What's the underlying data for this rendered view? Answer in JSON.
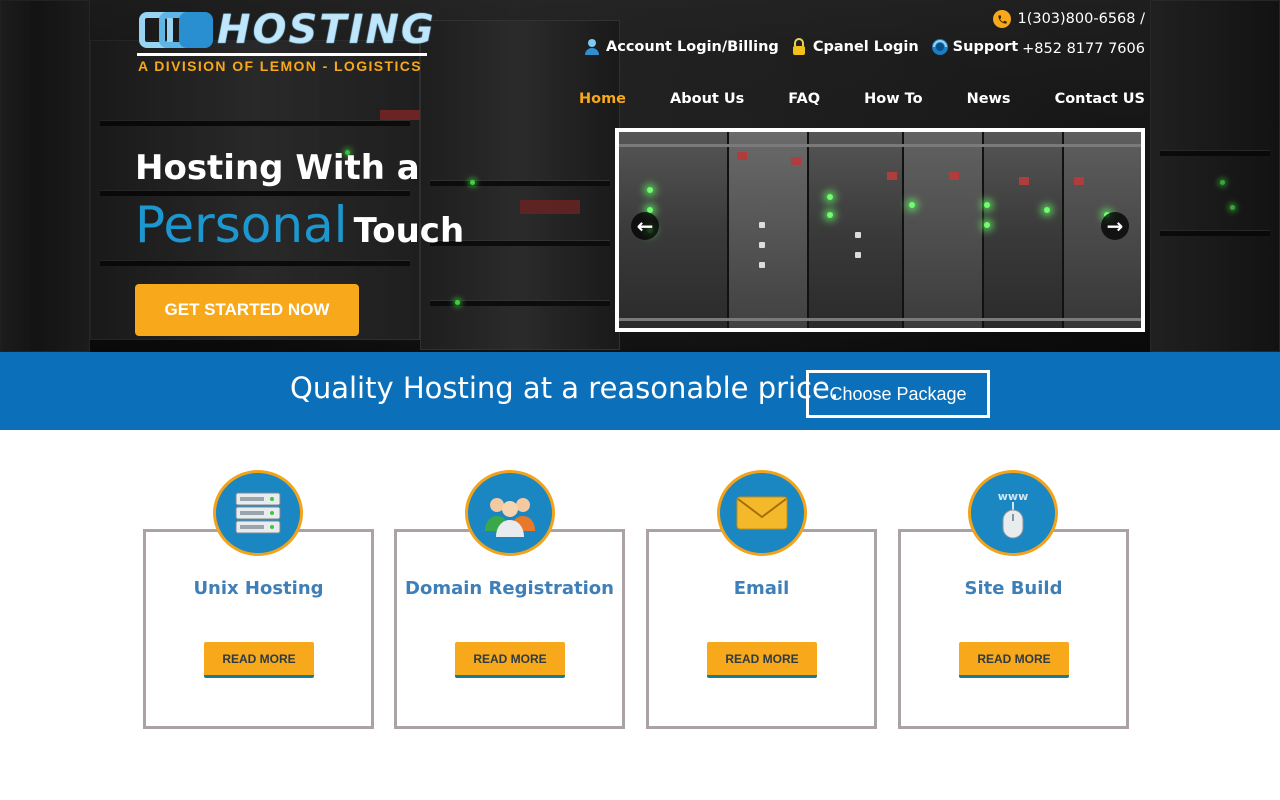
{
  "brand": {
    "logo_word": "HOSTING",
    "tagline": "A DIVISION OF LEMON - LOGISTICS"
  },
  "contact": {
    "phone_us": "1(303)800-6568 /",
    "phone_hk": "+852 8177 7606"
  },
  "toplinks": [
    {
      "label": "Account Login/Billing",
      "icon": "user-icon"
    },
    {
      "label": "Cpanel Login",
      "icon": "lock-icon"
    },
    {
      "label": "Support",
      "icon": "support-icon"
    }
  ],
  "nav": [
    {
      "label": "Home",
      "active": true
    },
    {
      "label": "About Us"
    },
    {
      "label": "FAQ"
    },
    {
      "label": "How To"
    },
    {
      "label": "News"
    },
    {
      "label": "Contact US"
    }
  ],
  "hero": {
    "line1": "Hosting With a",
    "line2_big": "Personal",
    "line2_small": "Touch",
    "cta": "GET STARTED NOW",
    "prev_arrow": "←",
    "next_arrow": "→"
  },
  "banner": {
    "text": "Quality Hosting at a reasonable price.",
    "button": "Choose Package"
  },
  "services": [
    {
      "title": "Unix Hosting",
      "icon": "server-icon",
      "button": "READ MORE"
    },
    {
      "title": "Domain Registration",
      "icon": "users-icon",
      "button": "READ MORE"
    },
    {
      "title": "Email",
      "icon": "envelope-icon",
      "button": "READ MORE"
    },
    {
      "title": "Site Build",
      "icon": "www-mouse-icon",
      "button": "READ MORE"
    }
  ],
  "colors": {
    "accent_orange": "#f7a81b",
    "brand_blue": "#0b6fba",
    "title_blue": "#3f7fb8",
    "personal_blue": "#1d97cf"
  }
}
